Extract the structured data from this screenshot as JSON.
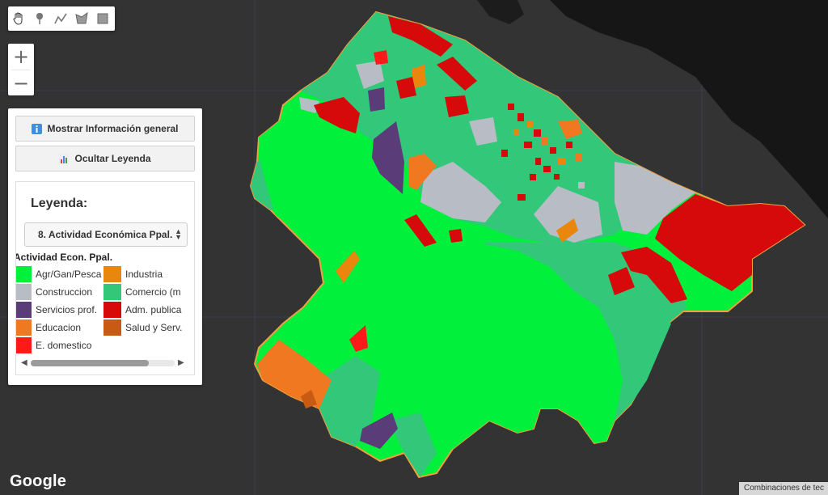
{
  "colors": {
    "background": "#333333",
    "water": "#161616",
    "agr": "#00f03c",
    "construccion": "#b8bcc4",
    "servicios": "#5a3d78",
    "educacion": "#f07820",
    "domestico": "#ff1a1a",
    "industria": "#e8860d",
    "comercio": "#33c77a",
    "adm": "#d60a0a",
    "salud": "#c85a14",
    "border": "#f0a040"
  },
  "toolbar": {
    "tools": [
      {
        "icon": "hand-pan-icon"
      },
      {
        "icon": "map-pin-icon"
      },
      {
        "icon": "polyline-icon"
      },
      {
        "icon": "polygon-icon"
      },
      {
        "icon": "rectangle-icon"
      }
    ]
  },
  "zoom": {
    "in": "+",
    "out": "−"
  },
  "panel": {
    "info_button": "Mostrar Información general",
    "legend_button": "Ocultar Leyenda",
    "legend_title": "Leyenda:",
    "select_value": "8. Actividad Económica Ppal.",
    "legend_subtitle": "Actividad Econ. Ppal.",
    "items": [
      {
        "label": "Agr/Gan/Pesca",
        "color": "#00f03c"
      },
      {
        "label": "Construccion",
        "color": "#b8bcc4"
      },
      {
        "label": "Servicios prof.",
        "color": "#5a3d78"
      },
      {
        "label": "Educacion",
        "color": "#f07820"
      },
      {
        "label": "E. domestico",
        "color": "#ff1a1a"
      },
      {
        "label": "Industria",
        "color": "#e8860d"
      },
      {
        "label": "Comercio (m",
        "color": "#33c77a"
      },
      {
        "label": "Adm. publica",
        "color": "#d60a0a"
      },
      {
        "label": "Salud y Serv.",
        "color": "#c85a14"
      }
    ]
  },
  "footer": {
    "google": "Google",
    "attribution": "Combinaciones de tec"
  }
}
